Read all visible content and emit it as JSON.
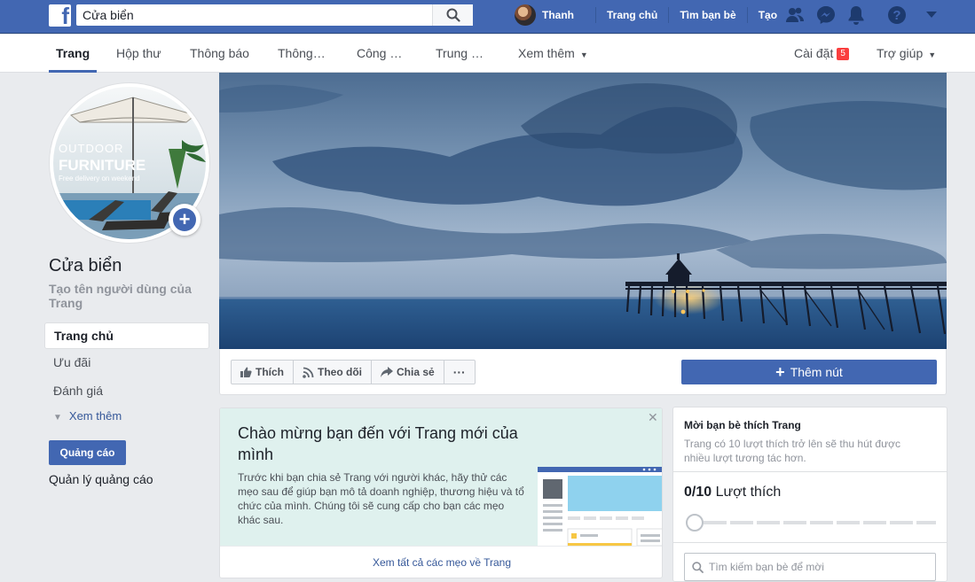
{
  "topbar": {
    "search_value": "Cửa biển",
    "user_name": "Thanh",
    "links": [
      "Trang chủ",
      "Tìm bạn bè",
      "Tạo"
    ]
  },
  "subnav": {
    "tabs": [
      "Trang",
      "Hộp thư",
      "Thông báo",
      "Thông…",
      "Công …",
      "Trung …",
      "Xem thêm"
    ],
    "settings_label": "Cài đặt",
    "settings_badge": "5",
    "help_label": "Trợ giúp"
  },
  "profile": {
    "name": "Cửa biển",
    "username_prompt": "Tạo tên người dùng của Trang",
    "picture_text": {
      "line1": "OUTDOOR",
      "line2": "FURNITURE",
      "line3": "Free delivery on weekend"
    }
  },
  "left_nav": {
    "items": [
      "Trang chủ",
      "Ưu đãi",
      "Đánh giá"
    ],
    "see_more": "Xem thêm",
    "ad_button": "Quảng cáo",
    "manage_ads": "Quản lý quảng cáo"
  },
  "cover_actions": {
    "like": "Thích",
    "follow": "Theo dõi",
    "share": "Chia sẻ",
    "more": "···",
    "add_button": "Thêm nút"
  },
  "welcome": {
    "title": "Chào mừng bạn đến với Trang mới của mình",
    "description": "Trước khi bạn chia sẻ Trang với người khác, hãy thử các mẹo sau để giúp bạn mô tả doanh nghiệp, thương hiệu và tổ chức của mình. Chúng tôi sẽ cung cấp cho bạn các mẹo khác sau.",
    "close": "✕",
    "link": "Xem tất cả các mẹo về Trang"
  },
  "invite": {
    "title": "Mời bạn bè thích Trang",
    "description": "Trang có 10 lượt thích trở lên sẽ thu hút được nhiều lượt tương tác hơn.",
    "likes_count": "0/10",
    "likes_label": "Lượt thích",
    "likes_progress": 0,
    "search_placeholder": "Tìm kiếm bạn bè để mời"
  },
  "colors": {
    "brand_blue": "#4267b2",
    "welcome_bg": "#dff1ee",
    "badge_red": "#fa3e3e"
  }
}
